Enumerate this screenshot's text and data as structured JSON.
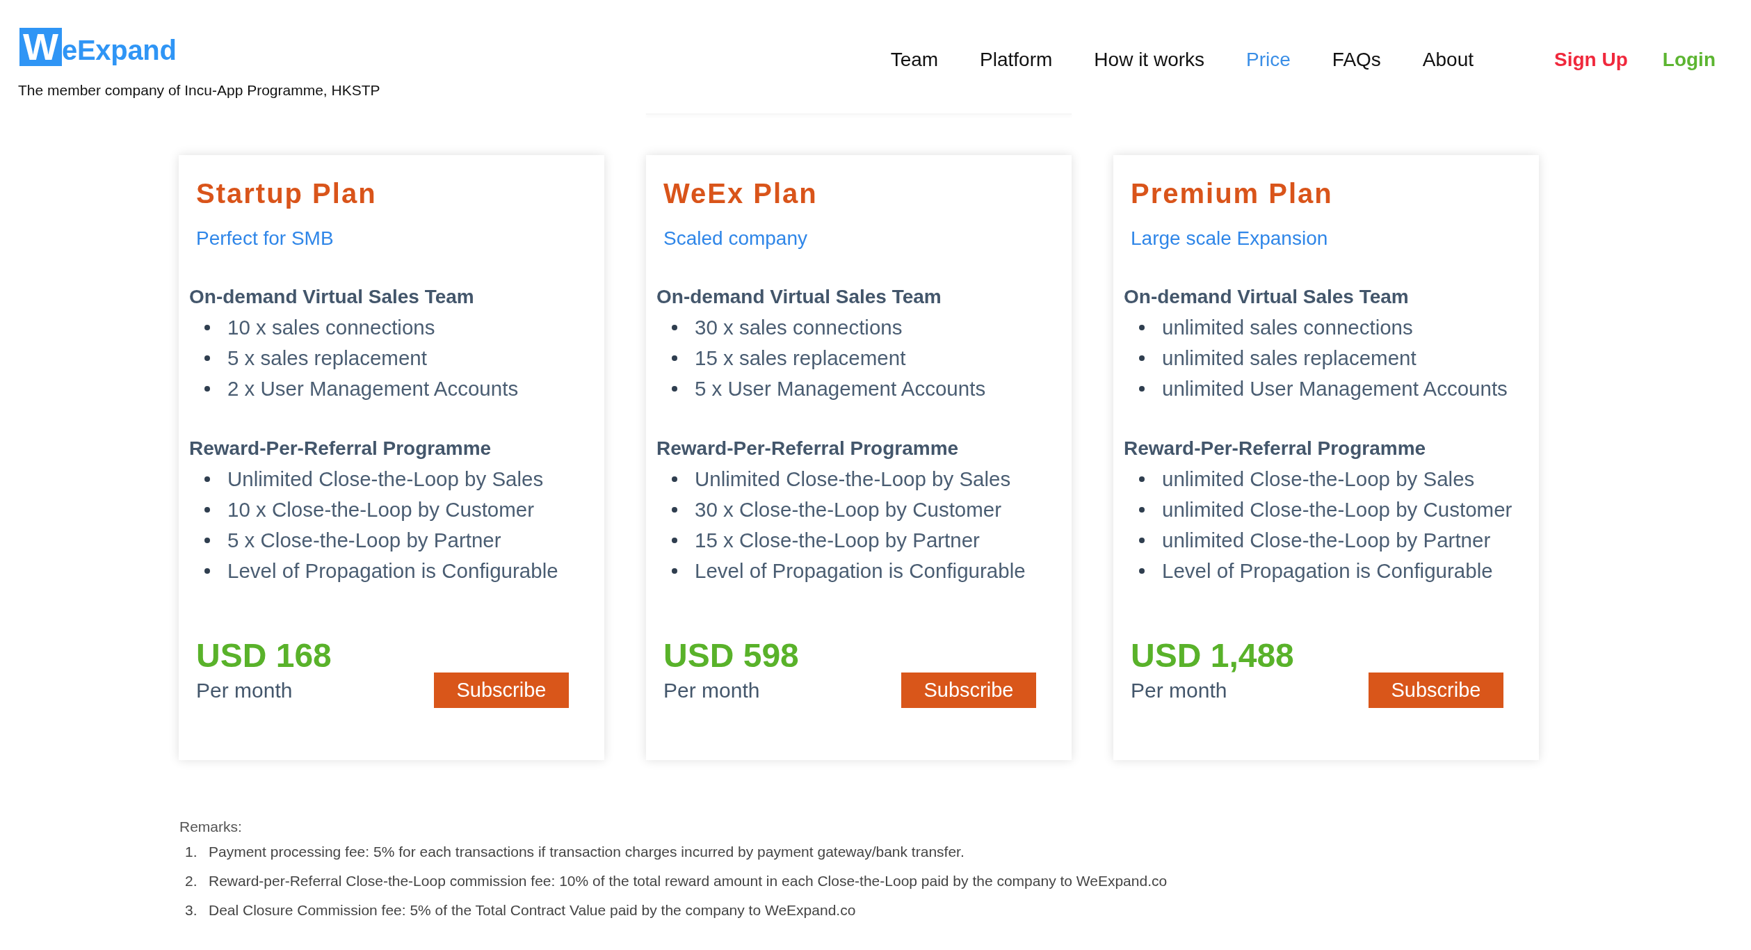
{
  "header": {
    "logo": {
      "letter": "W",
      "rest": "eExpand"
    },
    "tagline": "The member company of Incu-App Programme, HKSTP",
    "nav": [
      {
        "label": "Team",
        "selected": false
      },
      {
        "label": "Platform",
        "selected": false
      },
      {
        "label": "How it works",
        "selected": false
      },
      {
        "label": "Price",
        "selected": true
      },
      {
        "label": "FAQs",
        "selected": false
      },
      {
        "label": "About",
        "selected": false
      }
    ],
    "auth_links": [
      {
        "label": "Sign Up",
        "color": "#f0283c"
      },
      {
        "label": "Login",
        "color": "#5cb531"
      }
    ]
  },
  "plans": [
    {
      "title": "Startup Plan",
      "subtitle": "Perfect for SMB",
      "sections": [
        {
          "heading": "On-demand Virtual Sales Team",
          "items": [
            "10 x sales connections",
            "5 x sales replacement",
            "2 x User Management Accounts"
          ]
        },
        {
          "heading": "Reward-Per-Referral Programme",
          "items": [
            "Unlimited Close-the-Loop by Sales",
            "10 x Close-the-Loop by Customer",
            "5 x Close-the-Loop by Partner",
            "Level of Propagation is Configurable"
          ]
        }
      ],
      "price": "USD 168",
      "period": "Per month",
      "button": "Subscribe"
    },
    {
      "title": "WeEx Plan",
      "subtitle": "Scaled company",
      "sections": [
        {
          "heading": "On-demand Virtual Sales Team",
          "items": [
            "30 x sales connections",
            "15 x sales replacement",
            "5 x User Management Accounts"
          ]
        },
        {
          "heading": "Reward-Per-Referral Programme",
          "items": [
            "Unlimited Close-the-Loop by Sales",
            "30 x Close-the-Loop by Customer",
            "15 x Close-the-Loop by Partner",
            "Level of Propagation is Configurable"
          ]
        }
      ],
      "price": "USD 598",
      "period": "Per month",
      "button": "Subscribe"
    },
    {
      "title": "Premium Plan",
      "subtitle": "Large scale Expansion",
      "sections": [
        {
          "heading": "On-demand Virtual Sales Team",
          "items": [
            "unlimited sales connections",
            "unlimited sales replacement",
            "unlimited User Management Accounts"
          ]
        },
        {
          "heading": "Reward-Per-Referral Programme",
          "items": [
            "unlimited Close-the-Loop by Sales",
            "unlimited Close-the-Loop by Customer",
            "unlimited Close-the-Loop by Partner",
            "Level of Propagation is Configurable"
          ]
        }
      ],
      "price": "USD 1,488",
      "period": "Per month",
      "button": "Subscribe"
    }
  ],
  "remarks": {
    "title": "Remarks:",
    "items": [
      {
        "number": "1.",
        "text": "Payment processing fee: 5% for each transactions if transaction charges incurred by payment gateway/bank transfer."
      },
      {
        "number": "2.",
        "text": "Reward-per-Referral Close-the-Loop commission fee: 10% of the total reward amount in each Close-the-Loop paid by the company to WeExpand.co"
      },
      {
        "number": "3.",
        "text": "Deal Closure Commission fee: 5% of the Total Contract Value paid by the company to WeExpand.co"
      }
    ]
  }
}
